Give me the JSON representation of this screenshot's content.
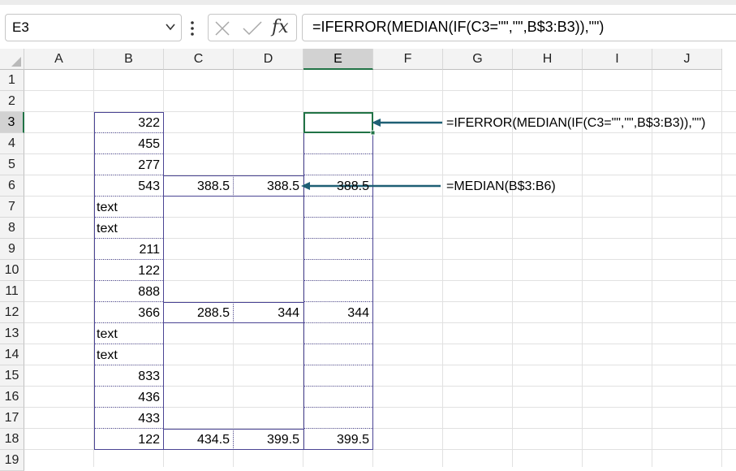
{
  "formula_bar": {
    "name_box": "E3",
    "fx_label": "fx",
    "formula": "=IFERROR(MEDIAN(IF(C3=\"\",\"\",B$3:B3)),\"\")"
  },
  "columns": [
    "A",
    "B",
    "C",
    "D",
    "E",
    "F",
    "G",
    "H",
    "I",
    "J"
  ],
  "rows": [
    "1",
    "2",
    "3",
    "4",
    "5",
    "6",
    "7",
    "8",
    "9",
    "10",
    "11",
    "12",
    "13",
    "14",
    "15",
    "16",
    "17",
    "18",
    "19"
  ],
  "selected": {
    "column": "E",
    "row": "3"
  },
  "cells": {
    "B3": "322",
    "B4": "455",
    "B5": "277",
    "B6": "543",
    "B7": "text",
    "B8": "text",
    "B9": "211",
    "B10": "122",
    "B11": "888",
    "B12": "366",
    "B13": "text",
    "B14": "text",
    "B15": "833",
    "B16": "436",
    "B17": "433",
    "B18": "122",
    "C6": "388.5",
    "D6": "388.5",
    "E6": "388.5",
    "C12": "288.5",
    "D12": "344",
    "E12": "344",
    "C18": "434.5",
    "D18": "399.5",
    "E18": "399.5"
  },
  "annotations": {
    "arrow1_formula": "=IFERROR(MEDIAN(IF(C3=\"\",\"\",B$3:B3)),\"\")",
    "arrow2_formula": "=MEDIAN(B$3:B6)"
  },
  "colors": {
    "accent": "#217346",
    "box_border": "#4a4494",
    "arrow": "#1e5f74"
  }
}
